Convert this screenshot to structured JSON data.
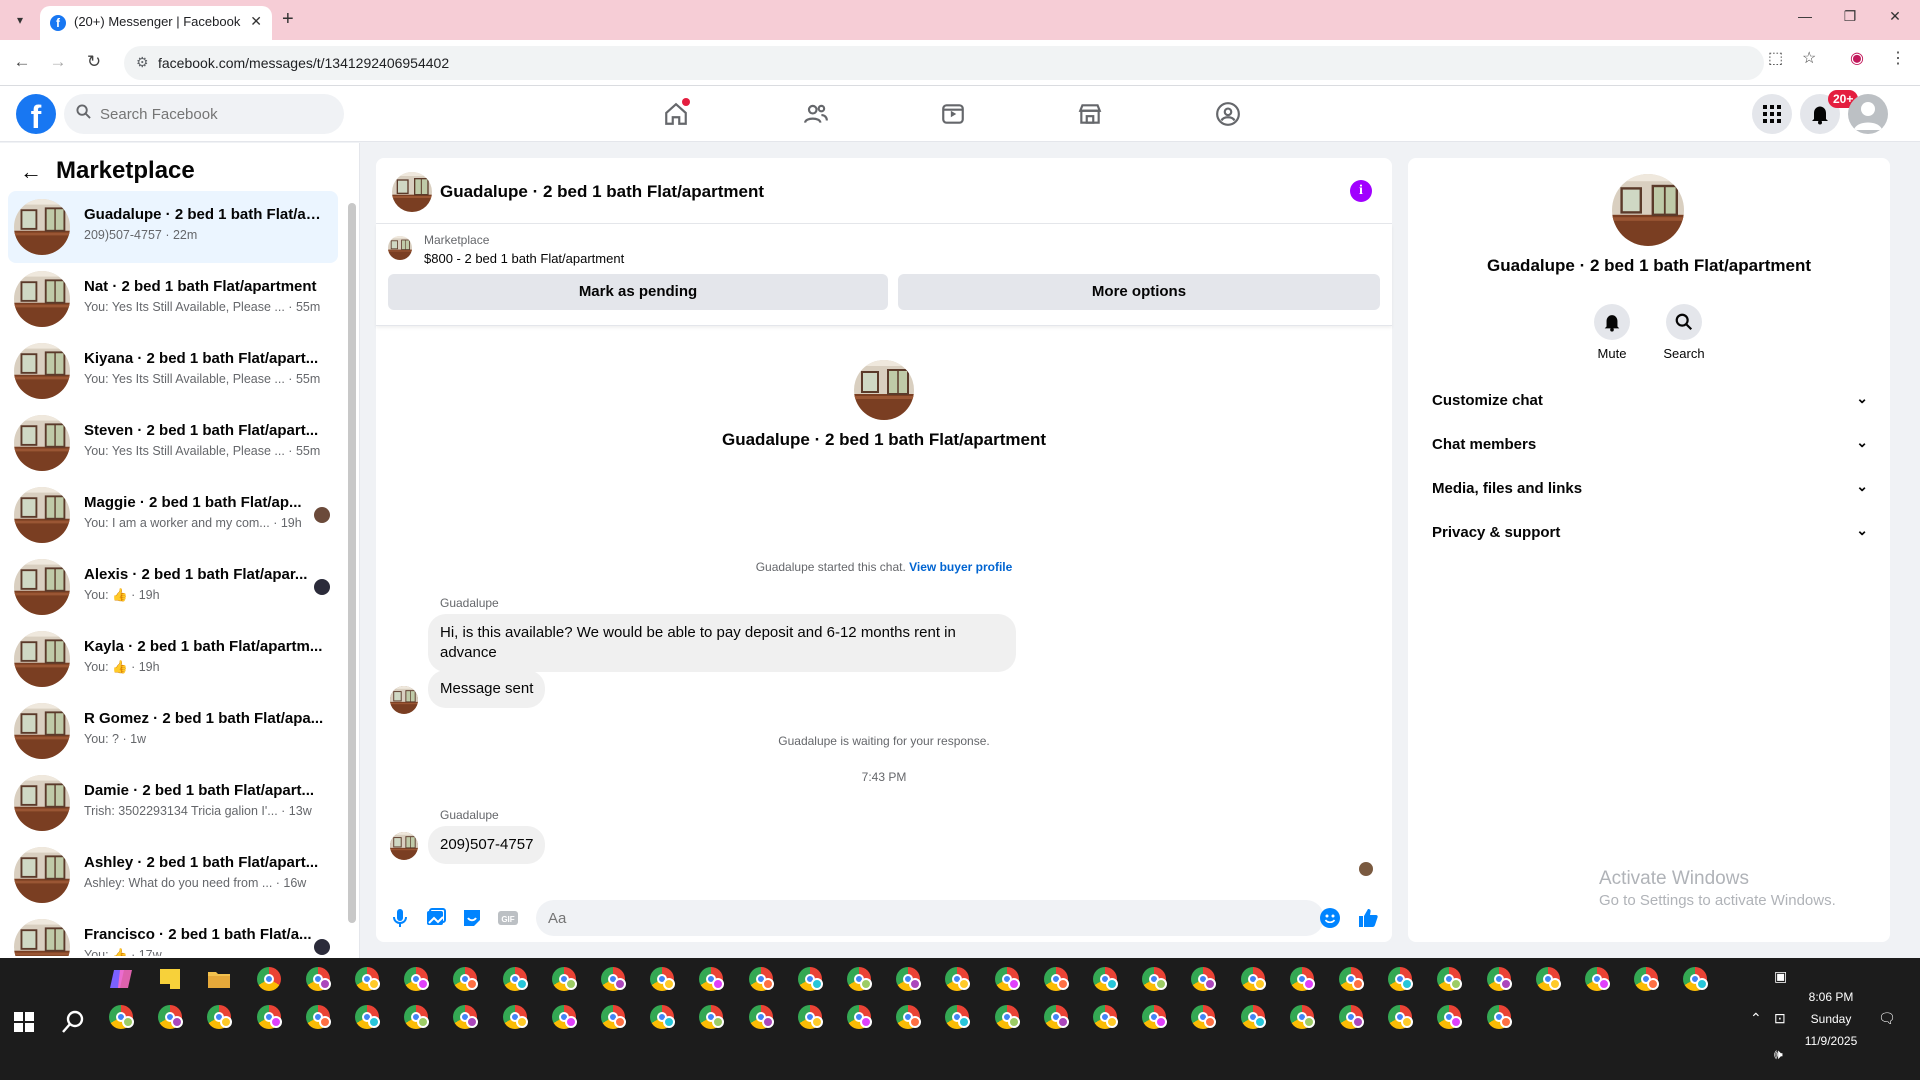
{
  "browser": {
    "tab_title": "(20+) Messenger | Facebook",
    "tab_favicon": "f",
    "url": "facebook.com/messages/t/1341292406954402"
  },
  "fb": {
    "logo": "f",
    "search_placeholder": "Search Facebook",
    "notif_badge": "20+",
    "nav_icons": [
      "home-icon",
      "friends-icon",
      "video-icon",
      "marketplace-icon",
      "groups-icon"
    ]
  },
  "sidebar": {
    "title": "Marketplace",
    "conversations": [
      {
        "name": "Guadalupe · 2 bed 1 bath Flat/ap...",
        "preview": "209)507-4757 · 22m",
        "active": true
      },
      {
        "name": "Nat · 2 bed 1 bath Flat/apartment",
        "preview": "You: Yes Its Still Available, Please ... · 55m"
      },
      {
        "name": "Kiyana · 2 bed 1 bath Flat/apart...",
        "preview": "You: Yes Its Still Available, Please ... · 55m"
      },
      {
        "name": "Steven · 2 bed 1 bath Flat/apart...",
        "preview": "You: Yes Its Still Available, Please ... · 55m"
      },
      {
        "name": "Maggie · 2 bed 1 bath Flat/ap...",
        "preview": "You: I am a worker and my com... · 19h"
      },
      {
        "name": "Alexis · 2 bed 1 bath Flat/apar...",
        "preview": "You: 👍 · 19h"
      },
      {
        "name": "Kayla · 2 bed 1 bath Flat/apartm...",
        "preview": "You: 👍 · 19h"
      },
      {
        "name": "R Gomez · 2 bed 1 bath Flat/apa...",
        "preview": "You: ? · 1w"
      },
      {
        "name": "Damie · 2 bed 1 bath Flat/apart...",
        "preview": "Trish: 3502293134 Tricia galion I'... · 13w"
      },
      {
        "name": "Ashley · 2 bed 1 bath Flat/apart...",
        "preview": "Ashley: What do you need from ... · 16w"
      },
      {
        "name": "Francisco · 2 bed 1 bath Flat/a...",
        "preview": "You: 👍 · 17w"
      }
    ]
  },
  "chat": {
    "title": "Guadalupe · 2 bed 1 bath Flat/apartment",
    "marketplace_label": "Marketplace",
    "listing": "$800 - 2 bed 1 bath Flat/apartment",
    "btn_pending": "Mark as pending",
    "btn_more": "More options",
    "intro_name": "Guadalupe · 2 bed 1 bath Flat/apartment",
    "started_text": "Guadalupe started this chat.",
    "view_profile": "View buyer profile",
    "sender": "Guadalupe",
    "msg1": "Hi, is this available? We would be able to pay deposit and 6-12 months rent in advance",
    "msg2": "Message sent",
    "waiting": "Guadalupe is waiting for your response.",
    "time": "7:43 PM",
    "msg3": "209)507-4757",
    "composer_placeholder": "Aa"
  },
  "rpanel": {
    "name": "Guadalupe · 2 bed 1 bath Flat/apartment",
    "mute": "Mute",
    "search": "Search",
    "rows": [
      "Customize chat",
      "Chat members",
      "Media, files and links",
      "Privacy & support"
    ]
  },
  "watermark": {
    "line1": "Activate Windows",
    "line2": "Go to Settings to activate Windows."
  },
  "taskbar": {
    "time": "8:06 PM",
    "day": "Sunday",
    "date": "11/9/2025"
  }
}
